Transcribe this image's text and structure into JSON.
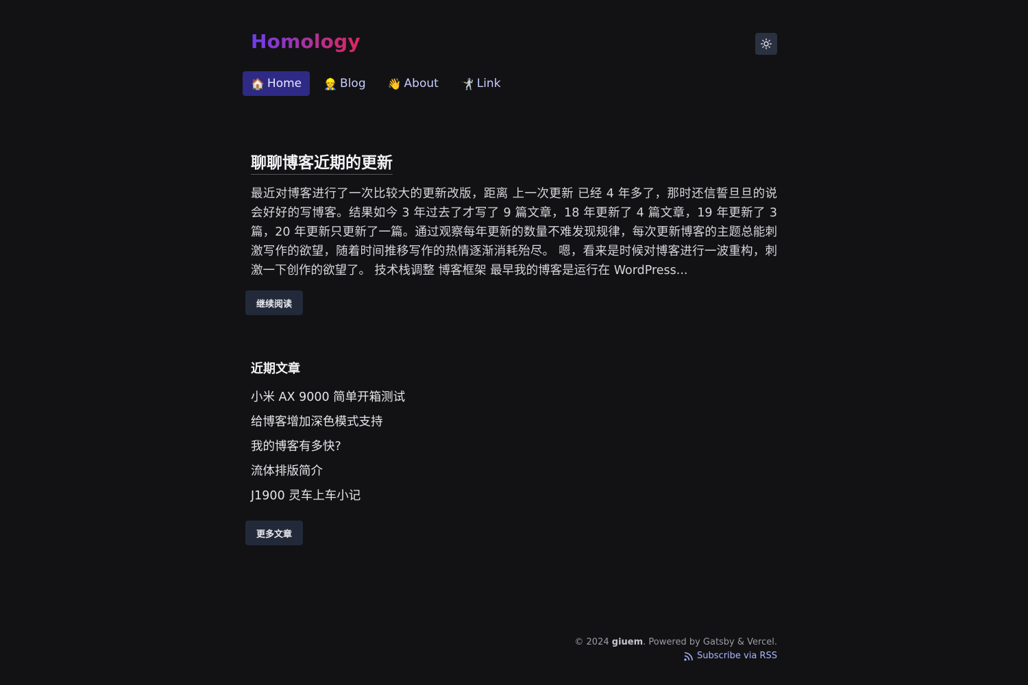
{
  "header": {
    "logo": "Homology",
    "theme_toggle_icon": "sun-icon"
  },
  "nav": [
    {
      "emoji": "🏠",
      "icon": "house-icon",
      "label": "Home",
      "active": true
    },
    {
      "emoji": "👷",
      "icon": "worker-icon",
      "label": "Blog",
      "active": false
    },
    {
      "emoji": "👋",
      "icon": "wave-icon",
      "label": "About",
      "active": false
    },
    {
      "emoji": "🤺",
      "icon": "fencer-icon",
      "label": "Link",
      "active": false
    }
  ],
  "post": {
    "title": "聊聊博客近期的更新",
    "excerpt": "最近对博客进行了一次比较大的更新改版，距离 上一次更新 已经 4 年多了，那时还信誓旦旦的说会好好的写博客。结果如今 3 年过去了才写了 9 篇文章，18 年更新了 4 篇文章，19 年更新了 3 篇，20 年更新只更新了一篇。通过观察每年更新的数量不难发现规律，每次更新博客的主题总能刺激写作的欲望，随着时间推移写作的热情逐渐消耗殆尽。 嗯，看来是时候对博客进行一波重构，刺激一下创作的欲望了。 技术栈调整 博客框架 最早我的博客是运行在 WordPress...",
    "read_more": "继续阅读"
  },
  "recent": {
    "heading": "近期文章",
    "items": [
      "小米 AX 9000 简单开箱测试",
      "给博客增加深色模式支持",
      "我的博客有多快?",
      "流体排版简介",
      "J1900 灵车上车小记"
    ],
    "more": "更多文章"
  },
  "footer": {
    "copyright_prefix": "© 2024 ",
    "author": "giuem",
    "powered": ". Powered by Gatsby & Vercel.",
    "rss": "Subscribe via RSS",
    "rss_icon": "rss-icon"
  },
  "colors": {
    "background": "#121214",
    "nav_active": "#2e2a86",
    "button_bg": "#222a3a",
    "link": "#a9b8ff"
  }
}
